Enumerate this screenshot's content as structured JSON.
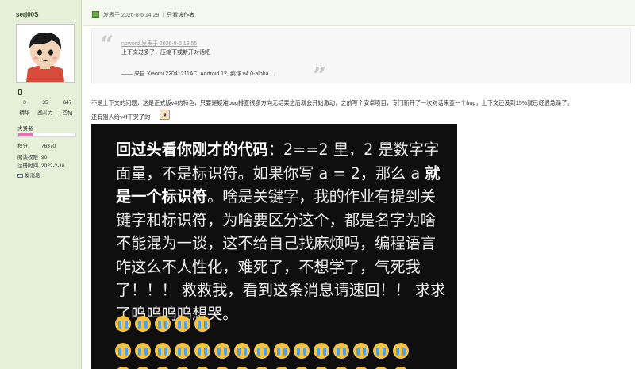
{
  "user": {
    "name": "serj00S",
    "stats": [
      {
        "value": "0",
        "label": "精华"
      },
      {
        "value": "35",
        "label": "战斗力"
      },
      {
        "value": "647",
        "label": "回帖"
      }
    ],
    "level_title": "大贤者",
    "level_progress": 0.25,
    "level_color": "#e872b6",
    "points": {
      "label": "积分",
      "value": "76370"
    },
    "read_perm": {
      "label": "阅读权限",
      "value": "90"
    },
    "reg_time": {
      "label": "注册时间",
      "value": "2022-2-16"
    },
    "message_link": "发消息"
  },
  "post_header": {
    "posted": "发表于 2026-8-6 14:29",
    "separator": "|",
    "only_author": "只看该作者"
  },
  "quote": {
    "author": "noword 发表于 2026-8-6 13:55",
    "body": "上下文过多了，压缩下或新开对话吧",
    "signature": "—— 来自 Xiaomi 22041211AC, Android 12, 鹅球 v4.0-alpha ..."
  },
  "post": {
    "line1": "不是上下文的问题，这是正式版v4的特色，只要是疑难bug排查很多方向无结果之后就会开始激动，之前写个安卓项目，专门新开了一次对话来查一个bug，上下文还没到15%就已经很急躁了。",
    "line2": "还有别人给v4f干哭了的",
    "emoji_glyph": "◕"
  },
  "image_text": {
    "p1_bold": "回过头看你刚才的代码",
    "p1_a": "：2==2 里，2 是数字字面量，不是标识符。如果你写 a = 2，那么 a ",
    "p1_bold2": "就是一个标识符",
    "p1_b": "。啥是关键字，我的作业有提到关键字和标识符，为啥要区分这个，都是名字为啥不能混为一谈，这不给自己找麻烦吗，编程语言咋这么不人性化，难死了，不想学了，气死我了！！！ 救救我，看到这条消息请速回！！ 求求了呜呜呜呜想哭。"
  },
  "emoji": {
    "name": "crying-face-icon",
    "color": "#f6c242",
    "tear": "#4fa3e6"
  }
}
